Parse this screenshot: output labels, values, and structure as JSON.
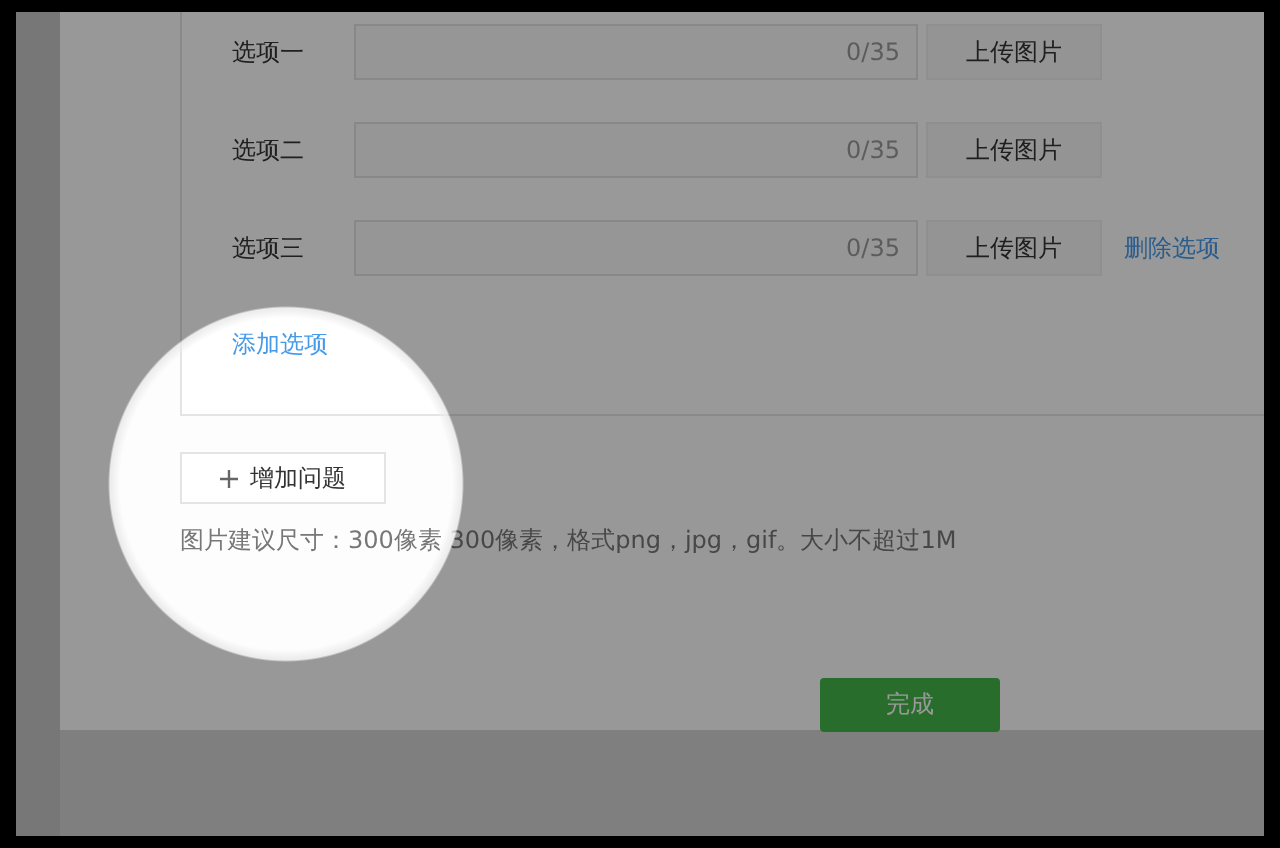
{
  "options": [
    {
      "label": "选项一",
      "counter": "0/35",
      "upload_button": "上传图片"
    },
    {
      "label": "选项二",
      "counter": "0/35",
      "upload_button": "上传图片"
    },
    {
      "label": "选项三",
      "counter": "0/35",
      "upload_button": "上传图片",
      "delete_link": "删除选项"
    }
  ],
  "add_option_link": "添加选项",
  "add_question_button": "增加问题",
  "hint": "图片建议尺寸：300像素 300像素，格式png，jpg，gif。大小不超过1M",
  "done_button": "完成"
}
